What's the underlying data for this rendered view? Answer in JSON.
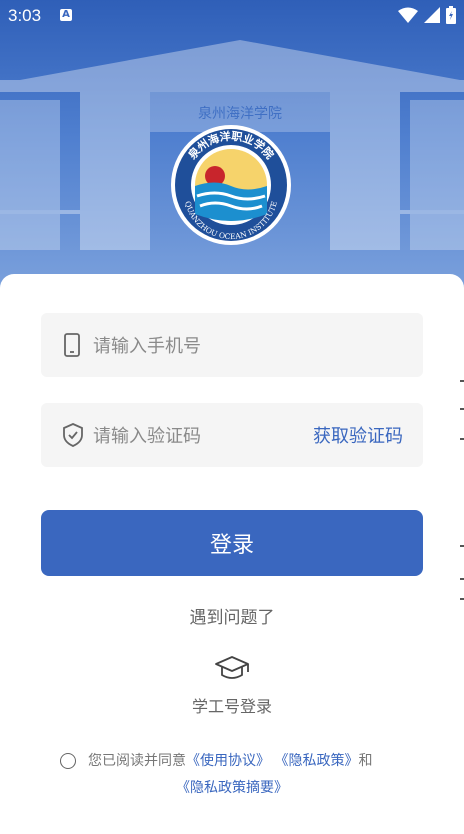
{
  "status_bar": {
    "time": "3:03",
    "notification_letter": "A"
  },
  "logo": {
    "cn_text": "泉州海洋职业学院",
    "en_text": "QUANZHOU OCEAN INSTITUTE"
  },
  "gate_sign": "泉州海洋学院",
  "login": {
    "phone_placeholder": "请输入手机号",
    "code_placeholder": "请输入验证码",
    "get_code_label": "获取验证码",
    "login_button_label": "登录",
    "problem_label": "遇到问题了",
    "student_login_label": "学工号登录"
  },
  "agreement": {
    "prefix": "您已阅读并同意",
    "terms_link": "《使用协议》",
    "privacy_link": "《隐私政策》",
    "conjunction": "和",
    "summary_link": "《隐私政策摘要》"
  },
  "colors": {
    "primary": "#3a67bf",
    "hero_top": "#2f5fb8",
    "field_bg": "#f5f5f5"
  },
  "icons": [
    "wifi-icon",
    "signal-icon",
    "battery-icon",
    "phone-icon",
    "shield-icon",
    "graduation-cap-icon"
  ]
}
